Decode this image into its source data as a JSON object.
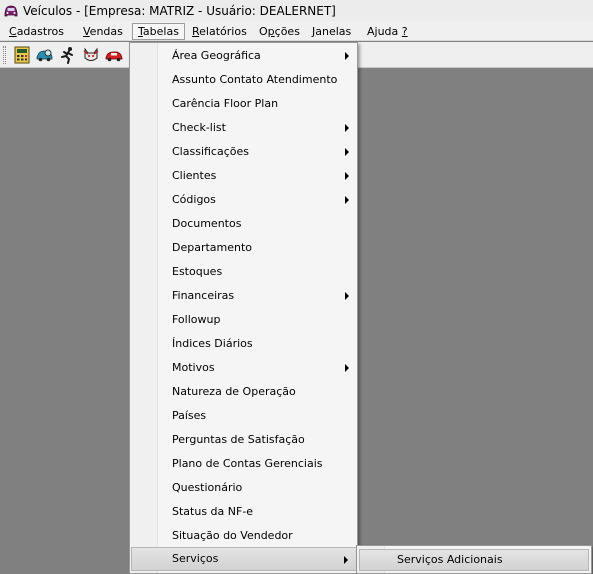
{
  "window": {
    "title": "Veículos - [Empresa: MATRIZ - Usuário: DEALERNET]",
    "icon": "car-app-icon"
  },
  "menubar": {
    "items": [
      {
        "label": "Cadastros",
        "accel": "C",
        "rest": "adastros"
      },
      {
        "label": "Vendas",
        "accel": "V",
        "rest": "endas"
      },
      {
        "label": "Tabelas",
        "accel": "T",
        "rest": "abelas"
      },
      {
        "label": "Relatórios",
        "accel": "R",
        "rest": "elatórios"
      },
      {
        "label": "Opções",
        "pre": "O",
        "accel": "p",
        "rest": "ções"
      },
      {
        "label": "Janelas",
        "accel": "J",
        "rest": "anelas"
      },
      {
        "label": "Ajuda ?",
        "pre": "Ajuda ",
        "accel": "?",
        "rest": ""
      }
    ]
  },
  "toolbar": {
    "buttons": [
      "calculator-icon",
      "car-search-icon",
      "running-man-icon",
      "cat-icon",
      "red-car-icon"
    ]
  },
  "tabelas_menu": {
    "items": [
      {
        "label": "Área Geográfica",
        "submenu": true
      },
      {
        "label": "Assunto Contato Atendimento",
        "submenu": false
      },
      {
        "label": "Carência Floor Plan",
        "submenu": false
      },
      {
        "label": "Check-list",
        "submenu": true
      },
      {
        "label": "Classificações",
        "submenu": true
      },
      {
        "label": "Clientes",
        "submenu": true
      },
      {
        "label": "Códigos",
        "submenu": true
      },
      {
        "label": "Documentos",
        "submenu": false
      },
      {
        "label": "Departamento",
        "submenu": false
      },
      {
        "label": "Estoques",
        "submenu": false
      },
      {
        "label": "Financeiras",
        "submenu": true
      },
      {
        "label": "Followup",
        "submenu": false
      },
      {
        "label": "Índices Diários",
        "submenu": false
      },
      {
        "label": "Motivos",
        "submenu": true
      },
      {
        "label": "Natureza de Operação",
        "submenu": false
      },
      {
        "label": "Países",
        "submenu": false
      },
      {
        "label": "Perguntas de Satisfação",
        "submenu": false
      },
      {
        "label": "Plano de Contas Gerenciais",
        "submenu": false
      },
      {
        "label": "Questionário",
        "submenu": false
      },
      {
        "label": "Status da NF-e",
        "submenu": false
      },
      {
        "label": "Situação do Vendedor",
        "submenu": false
      },
      {
        "label": "Serviços",
        "submenu": true,
        "highlighted": true
      }
    ]
  },
  "servicos_submenu": {
    "items": [
      {
        "label": "Serviços Adicionais"
      }
    ]
  }
}
